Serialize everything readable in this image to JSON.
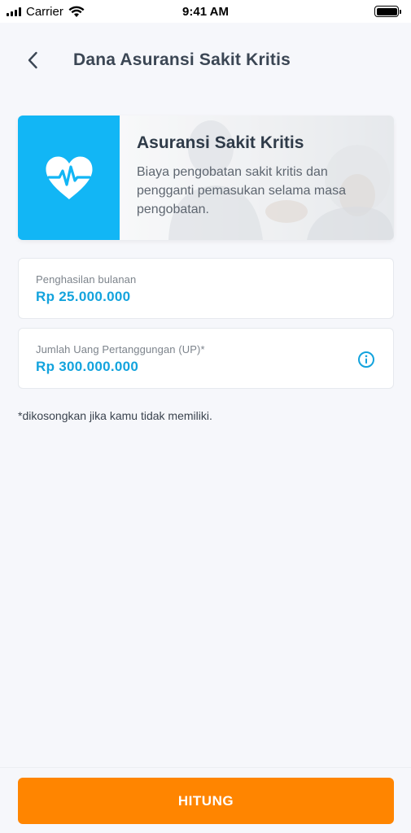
{
  "status_bar": {
    "carrier": "Carrier",
    "time": "9:41 AM",
    "icons": [
      "signal-icon",
      "wifi-icon",
      "battery-icon"
    ]
  },
  "header": {
    "back_icon": "chevron-left-icon",
    "title": "Dana Asuransi Sakit Kritis"
  },
  "banner": {
    "icon": "heart-pulse-icon",
    "title": "Asuransi Sakit Kritis",
    "description": "Biaya pengobatan sakit kritis dan pengganti pemasukan selama masa pengobatan."
  },
  "fields": [
    {
      "label": "Penghasilan bulanan",
      "value": "Rp 25.000.000"
    },
    {
      "label": "Jumlah Uang Pertanggungan (UP)*",
      "value": "Rp 300.000.000",
      "icon": "info-icon"
    }
  ],
  "footnote": "*dikosongkan jika kamu tidak memiliki.",
  "action": {
    "label": "HITUNG"
  },
  "colors": {
    "accent_blue": "#13a3dd",
    "banner_blue": "#12b6f5",
    "button_orange": "#ff8500",
    "background": "#f6f7fb"
  }
}
